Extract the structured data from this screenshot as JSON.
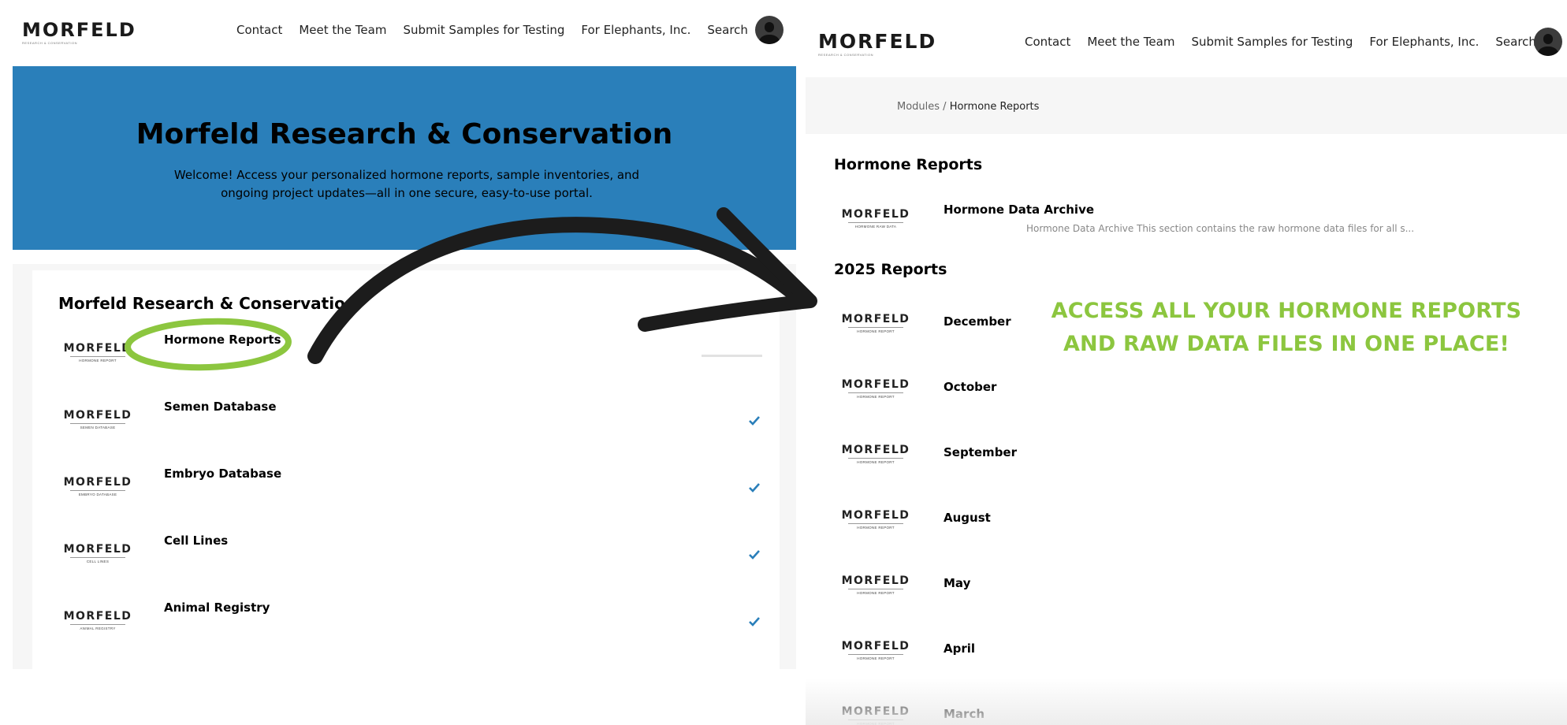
{
  "colors": {
    "hero_blue": "#2a7fba",
    "accent_green": "#8cc63f",
    "check_blue": "#2a7fba",
    "arrow": "#1c1c1c"
  },
  "left": {
    "logo": {
      "word": "MORFELD",
      "sub": "RESEARCH & CONSERVATION"
    },
    "nav": [
      "Contact",
      "Meet the Team",
      "Submit Samples for Testing",
      "For Elephants, Inc.",
      "Search"
    ],
    "hero": {
      "title": "Morfeld Research & Conservation",
      "text": "Welcome! Access your personalized hormone reports, sample inventories, and ongoing project updates—all in one secure, easy-to-use portal."
    },
    "card_title": "Morfeld Research & Conservation",
    "modules": [
      {
        "label": "Hormone Reports",
        "thumb_sub": "HORMONE REPORT",
        "status": "in-progress",
        "highlighted": true
      },
      {
        "label": "Semen Database",
        "thumb_sub": "SEMEN DATABASE",
        "status": "complete"
      },
      {
        "label": "Embryo Database",
        "thumb_sub": "EMBRYO DATABASE",
        "status": "complete"
      },
      {
        "label": "Cell Lines",
        "thumb_sub": "CELL LINES",
        "status": "complete"
      },
      {
        "label": "Animal Registry",
        "thumb_sub": "ANIMAL REGISTRY",
        "status": "complete"
      }
    ]
  },
  "right": {
    "logo": {
      "word": "MORFELD",
      "sub": "RESEARCH & CONSERVATION"
    },
    "nav": [
      "Contact",
      "Meet the Team",
      "Submit Samples for Testing",
      "For Elephants, Inc.",
      "Search"
    ],
    "breadcrumb": {
      "parent": "Modules",
      "separator": " / ",
      "current": "Hormone Reports"
    },
    "section_title": "Hormone Reports",
    "archive": {
      "label": "Hormone Data Archive",
      "thumb_sub": "HORMONE RAW DATA",
      "description": "Hormone Data Archive This section contains the raw hormone data files for all s..."
    },
    "reports_title": "2025 Reports",
    "reports": [
      {
        "label": "December",
        "thumb_sub": "HORMONE REPORT"
      },
      {
        "label": "October",
        "thumb_sub": "HORMONE REPORT"
      },
      {
        "label": "September",
        "thumb_sub": "HORMONE REPORT"
      },
      {
        "label": "August",
        "thumb_sub": "HORMONE REPORT"
      },
      {
        "label": "May",
        "thumb_sub": "HORMONE REPORT"
      },
      {
        "label": "April",
        "thumb_sub": "HORMONE REPORT"
      },
      {
        "label": "March",
        "thumb_sub": "HORMONE REPORT"
      }
    ],
    "callout": [
      "ACCESS ALL YOUR HORMONE REPORTS",
      "AND RAW DATA FILES IN ONE PLACE!"
    ]
  }
}
